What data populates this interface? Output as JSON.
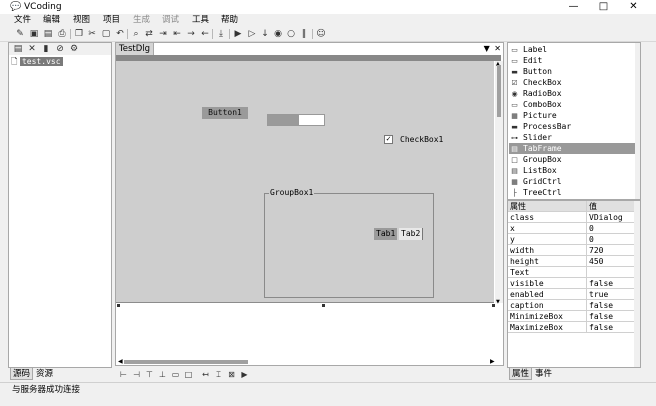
{
  "window": {
    "title": "VCoding",
    "minimize_label": "—",
    "maximize_label": "□",
    "close_label": "✕"
  },
  "menu": [
    "文件",
    "编辑",
    "视图",
    "项目",
    "生成",
    "调试",
    "工具",
    "帮助"
  ],
  "toolbar_icons": [
    "new-icon",
    "save-icon",
    "save-all-icon",
    "print-icon",
    "copy-icon",
    "cut-icon",
    "paste-icon",
    "undo-icon",
    "search-icon",
    "replace-icon",
    "indent-icon",
    "outdent-icon",
    "comment-icon",
    "uncomment-icon",
    "build-icon",
    "run-icon",
    "debug-icon",
    "step-icon",
    "watch-icon",
    "stop-icon",
    "pause-icon",
    "user-icon"
  ],
  "project": {
    "file": "test.vsc",
    "tabs": [
      "源码",
      "资源"
    ]
  },
  "editor": {
    "tab": "TestDlg",
    "dialog": {
      "button_label": "Button1",
      "slider_value_fraction": 0.55,
      "checkbox_label": "CheckBox1",
      "checkbox_checked": true,
      "groupbox_label": "GroupBox1",
      "tabs": [
        "Tab1",
        "Tab2"
      ]
    }
  },
  "controls": [
    {
      "icon": "label-icon",
      "label": "Label"
    },
    {
      "icon": "edit-icon",
      "label": "Edit"
    },
    {
      "icon": "button-icon",
      "label": "Button"
    },
    {
      "icon": "checkbox-icon",
      "label": "CheckBox"
    },
    {
      "icon": "radiobox-icon",
      "label": "RadioBox"
    },
    {
      "icon": "combobox-icon",
      "label": "ComboBox"
    },
    {
      "icon": "picture-icon",
      "label": "Picture"
    },
    {
      "icon": "processbar-icon",
      "label": "ProcessBar"
    },
    {
      "icon": "slider-icon",
      "label": "Slider"
    },
    {
      "icon": "tabframe-icon",
      "label": "TabFrame"
    },
    {
      "icon": "groupbox-icon",
      "label": "GroupBox"
    },
    {
      "icon": "listbox-icon",
      "label": "ListBox"
    },
    {
      "icon": "gridctrl-icon",
      "label": "GridCtrl"
    },
    {
      "icon": "treectrl-icon",
      "label": "TreeCtrl"
    }
  ],
  "selected_control": "TabFrame",
  "properties": {
    "header": {
      "key": "属性",
      "value": "值"
    },
    "rows": [
      {
        "key": "class",
        "value": "VDialog"
      },
      {
        "key": "x",
        "value": "0"
      },
      {
        "key": "y",
        "value": "0"
      },
      {
        "key": "width",
        "value": "720"
      },
      {
        "key": "height",
        "value": "450"
      },
      {
        "key": "Text",
        "value": ""
      },
      {
        "key": "visible",
        "value": "false"
      },
      {
        "key": "enabled",
        "value": "true"
      },
      {
        "key": "caption",
        "value": "false"
      },
      {
        "key": "MinimizeBox",
        "value": "false"
      },
      {
        "key": "MaximizeBox",
        "value": "false"
      }
    ],
    "tabs": [
      "属性",
      "事件"
    ]
  },
  "status": "与服务器成功连接"
}
